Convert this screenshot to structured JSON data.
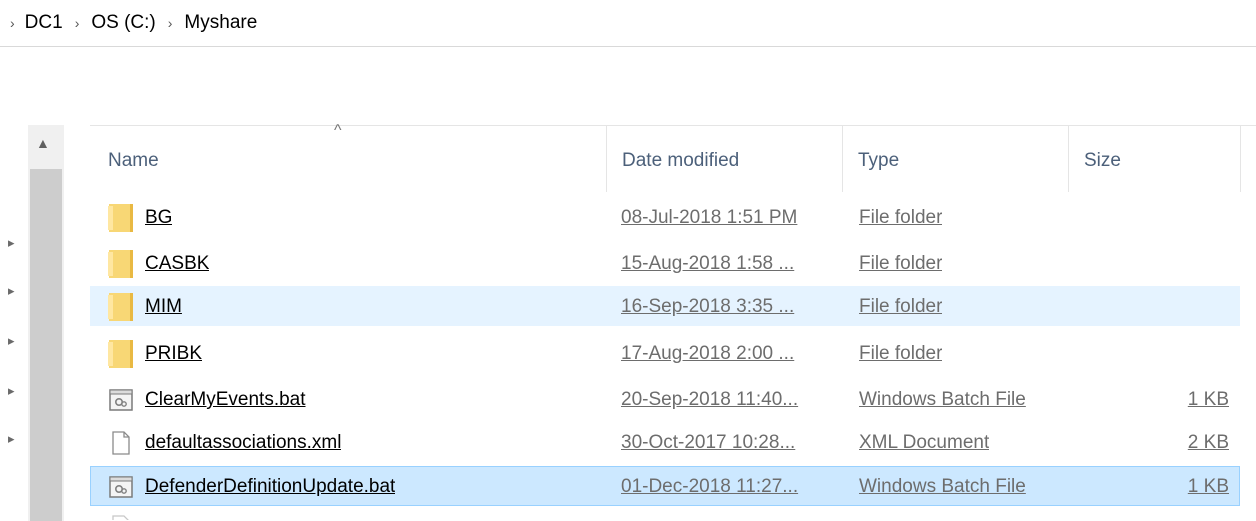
{
  "breadcrumb": {
    "items": [
      "DC1",
      "OS (C:)",
      "Myshare"
    ],
    "separator": "›"
  },
  "columns": {
    "name": "Name",
    "date_modified": "Date modified",
    "type": "Type",
    "size": "Size"
  },
  "files": [
    {
      "name": "BG",
      "date": "08-Jul-2018 1:51 PM",
      "type": "File folder",
      "size": "",
      "icon": "folder-icon",
      "state": "normal"
    },
    {
      "name": "CASBK",
      "date": "15-Aug-2018 1:58 ...",
      "type": "File folder",
      "size": "",
      "icon": "folder-icon",
      "state": "normal"
    },
    {
      "name": "MIM",
      "date": "16-Sep-2018 3:35 ...",
      "type": "File folder",
      "size": "",
      "icon": "folder-icon",
      "state": "hover"
    },
    {
      "name": "PRIBK",
      "date": "17-Aug-2018 2:00 ...",
      "type": "File folder",
      "size": "",
      "icon": "folder-icon",
      "state": "normal"
    },
    {
      "name": "ClearMyEvents.bat",
      "date": "20-Sep-2018 11:40...",
      "type": "Windows Batch File",
      "size": "1 KB",
      "icon": "batch-file-icon",
      "state": "normal"
    },
    {
      "name": "defaultassociations.xml",
      "date": "30-Oct-2017 10:28...",
      "type": "XML Document",
      "size": "2 KB",
      "icon": "document-icon",
      "state": "normal"
    },
    {
      "name": "DefenderDefinitionUpdate.bat",
      "date": "01-Dec-2018 11:27...",
      "type": "Windows Batch File",
      "size": "1 KB",
      "icon": "batch-file-icon",
      "state": "selected"
    }
  ],
  "colors": {
    "hover_row": "#e5f3ff",
    "selected_row": "#cce8ff",
    "selected_border": "#99d1ff",
    "header_text": "#4c607a",
    "folder": "#f8d775"
  }
}
